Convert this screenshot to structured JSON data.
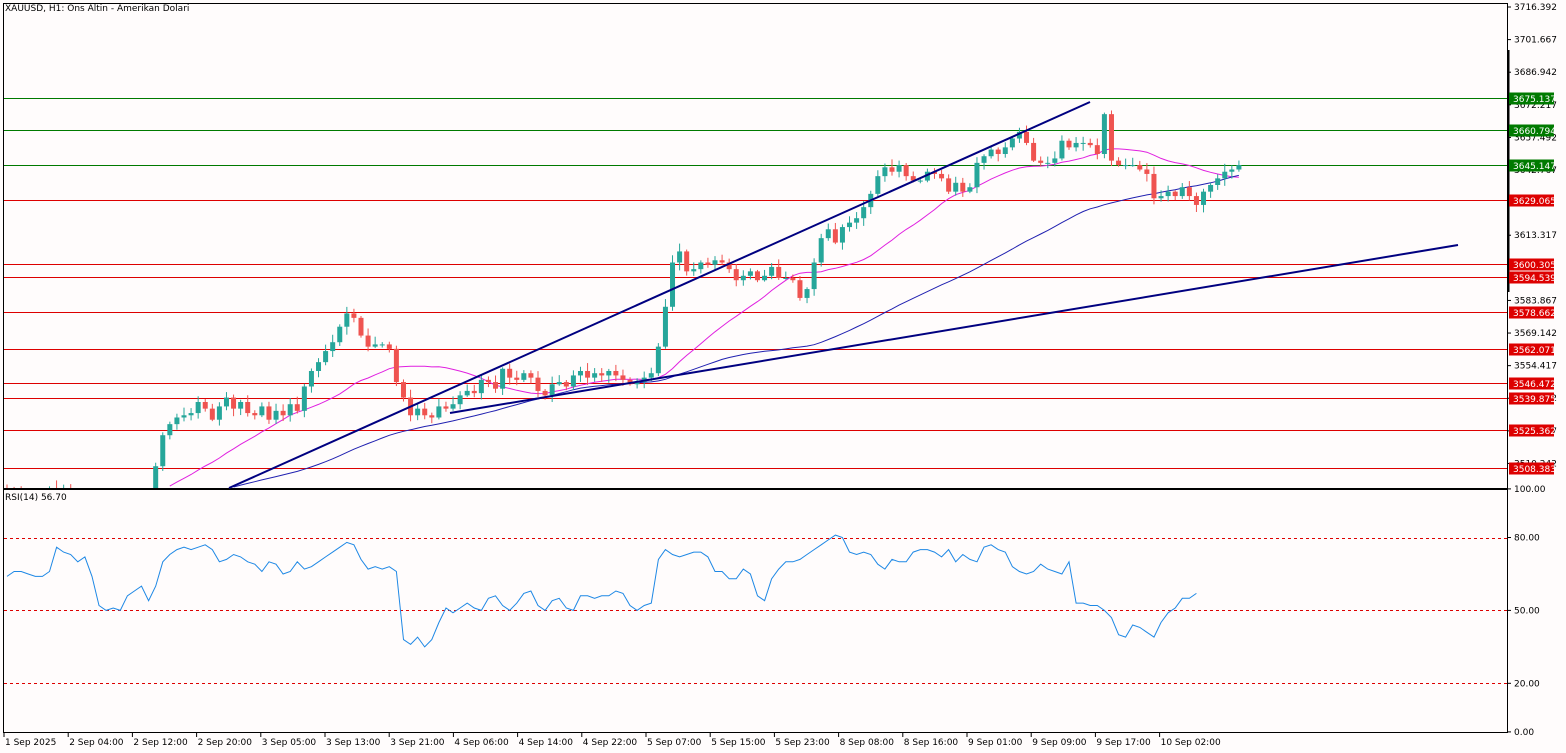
{
  "chart_title": "XAUUSD, H1:  Ons Altin - Amerikan Dolari",
  "rsi_label": "RSI(14) 56.70",
  "colors": {
    "background": "#fffcfc",
    "bull": "#26a69a",
    "bear": "#ef5350",
    "support_line": "#dd0000",
    "resistance_line": "#007a00",
    "trendline": "#000080",
    "ma_fast": "#e020e0",
    "ma_slow": "#2020b0",
    "rsi": "#1e88e5"
  },
  "chart_data": [
    {
      "type": "candlestick",
      "y_range": [
        3500,
        3716.392
      ],
      "price_axis_ticks": [
        "3716.392",
        "3701.667",
        "3686.942",
        "3672.217",
        "3657.492",
        "3642.767",
        "3613.317",
        "3583.867",
        "3569.142",
        "3554.417",
        "3539.692",
        "3524.967",
        "3510.242"
      ],
      "x_labels": [
        "1 Sep 2025",
        "2 Sep 04:00",
        "2 Sep 12:00",
        "2 Sep 20:00",
        "3 Sep 05:00",
        "3 Sep 13:00",
        "3 Sep 21:00",
        "4 Sep 06:00",
        "4 Sep 14:00",
        "4 Sep 22:00",
        "5 Sep 07:00",
        "5 Sep 15:00",
        "5 Sep 23:00",
        "8 Sep 08:00",
        "8 Sep 16:00",
        "9 Sep 01:00",
        "9 Sep 09:00",
        "9 Sep 17:00",
        "10 Sep 02:00"
      ],
      "resistance_levels": [
        "3675.137",
        "3660.794",
        "3645.147"
      ],
      "support_levels": [
        "3629.065",
        "3600.305",
        "3594.539",
        "3578.662",
        "3562.071",
        "3546.472",
        "3539.875",
        "3525.362",
        "3508.383"
      ],
      "closes": [
        3498,
        3497,
        3496,
        3496,
        3495,
        3497,
        3499,
        3498,
        3498,
        3497,
        3497,
        3496,
        3496,
        3497,
        3497,
        3496,
        3495,
        3495,
        3496,
        3495,
        3496,
        3509,
        3523,
        3528,
        3531,
        3532,
        3533,
        3538,
        3535,
        3530,
        3536,
        3540,
        3535,
        3538,
        3533,
        3532,
        3536,
        3530,
        3534,
        3532,
        3537,
        3534,
        3545,
        3552,
        3556,
        3561,
        3565,
        3572,
        3578,
        3576,
        3568,
        3563,
        3564,
        3564,
        3562,
        3547,
        3540,
        3532,
        3535,
        3532,
        3531,
        3536,
        3535,
        3537,
        3541,
        3543,
        3542,
        3548,
        3547,
        3544,
        3553,
        3549,
        3548,
        3551,
        3549,
        3543,
        3541,
        3546,
        3547,
        3545,
        3550,
        3552,
        3549,
        3551,
        3550,
        3552,
        3550,
        3548,
        3546,
        3547,
        3549,
        3551,
        3563,
        3581,
        3601,
        3606,
        3597,
        3598,
        3601,
        3600,
        3602,
        3601,
        3598,
        3593,
        3595,
        3597,
        3593,
        3595,
        3599,
        3594,
        3594,
        3593,
        3585,
        3589,
        3601,
        3612,
        3616,
        3610,
        3617,
        3619,
        3621,
        3626,
        3632,
        3640,
        3644,
        3642,
        3645,
        3640,
        3638,
        3638,
        3642,
        3641,
        3639,
        3633,
        3637,
        3633,
        3635,
        3646,
        3649,
        3652,
        3650,
        3653,
        3657,
        3660,
        3655,
        3647,
        3646,
        3646,
        3648,
        3656,
        3653,
        3655,
        3655,
        3654,
        3650,
        3668,
        3647,
        3645,
        3645,
        3645,
        3643,
        3641,
        3630,
        3631,
        3633,
        3631,
        3635,
        3631,
        3627,
        3633,
        3636,
        3639,
        3642,
        3643,
        3645
      ]
    },
    {
      "type": "line",
      "title": "RSI(14) 56.70",
      "y_range": [
        0,
        100
      ],
      "y_ticks": [
        "100.00",
        "80.00",
        "50.00",
        "20.00",
        "0.00"
      ],
      "levels": [
        80,
        50,
        20
      ],
      "rsi_values": [
        64,
        66,
        66,
        65,
        64,
        64,
        66,
        76,
        74,
        73,
        70,
        72,
        64,
        52,
        50,
        51,
        50,
        56,
        58,
        60,
        54,
        60,
        70,
        73,
        75,
        76,
        75,
        76,
        77,
        75,
        70,
        71,
        73,
        72,
        70,
        69,
        66,
        70,
        69,
        65,
        66,
        70,
        67,
        68,
        70,
        72,
        74,
        76,
        78,
        77,
        71,
        67,
        68,
        67,
        68,
        66,
        38,
        36,
        39,
        35,
        38,
        45,
        51,
        49,
        51,
        53,
        51,
        50,
        55,
        56,
        52,
        50,
        53,
        57,
        58,
        52,
        50,
        54,
        55,
        51,
        50,
        56,
        56,
        55,
        56,
        56,
        58,
        57,
        52,
        50,
        52,
        53,
        71,
        75,
        73,
        72,
        73,
        74,
        74,
        72,
        66,
        66,
        63,
        63,
        67,
        65,
        56,
        54,
        63,
        67,
        70,
        70,
        71,
        73,
        75,
        77,
        79,
        81,
        80,
        74,
        73,
        74,
        73,
        69,
        67,
        71,
        70,
        70,
        74,
        75,
        75,
        74,
        72,
        75,
        70,
        73,
        71,
        70,
        76,
        77,
        75,
        74,
        68,
        66,
        65,
        66,
        69,
        67,
        66,
        65,
        70,
        53,
        53,
        52,
        52,
        50,
        47,
        40,
        39,
        44,
        43,
        41,
        39,
        45,
        49,
        51,
        55,
        55,
        57
      ]
    }
  ]
}
